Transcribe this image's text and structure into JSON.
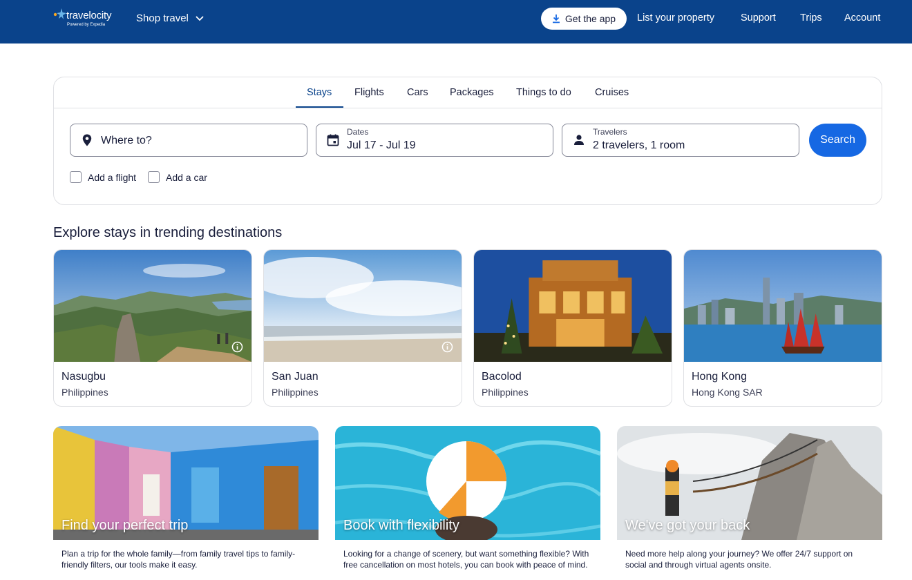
{
  "header": {
    "logo_text": "travelocity",
    "logo_subtext": "Powered by Expedia",
    "shop_travel": "Shop travel",
    "get_app": "Get the app",
    "nav": [
      "List your property",
      "Support",
      "Trips",
      "Account"
    ],
    "colors": {
      "bar": "#0a438b",
      "accent": "#1668e3"
    }
  },
  "search": {
    "tabs": [
      "Stays",
      "Flights",
      "Cars",
      "Packages",
      "Things to do",
      "Cruises"
    ],
    "active_tab": "Stays",
    "destination_placeholder": "Where to?",
    "dates_label": "Dates",
    "dates_value": "Jul 17 - Jul 19",
    "travelers_label": "Travelers",
    "travelers_value": "2 travelers, 1 room",
    "search_button": "Search",
    "add_flight": "Add a flight",
    "add_car": "Add a car",
    "icons": [
      "map-pin-icon",
      "calendar-icon",
      "person-icon"
    ]
  },
  "trending": {
    "title": "Explore stays in trending destinations",
    "destinations": [
      {
        "name": "Nasugbu",
        "country": "Philippines"
      },
      {
        "name": "San Juan",
        "country": "Philippines"
      },
      {
        "name": "Bacolod",
        "country": "Philippines"
      },
      {
        "name": "Hong Kong",
        "country": "Hong Kong SAR"
      }
    ]
  },
  "promos": [
    {
      "title": "Find your perfect trip",
      "description": "Plan a trip for the whole family—from family travel tips to family-friendly filters, our tools make it easy."
    },
    {
      "title": "Book with flexibility",
      "description": "Looking for a change of scenery, but want something flexible? With free cancellation on most hotels, you can book with peace of mind."
    },
    {
      "title": "We've got your back",
      "description": "Need more help along your journey? We offer 24/7 support on social and through virtual agents onsite."
    }
  ]
}
